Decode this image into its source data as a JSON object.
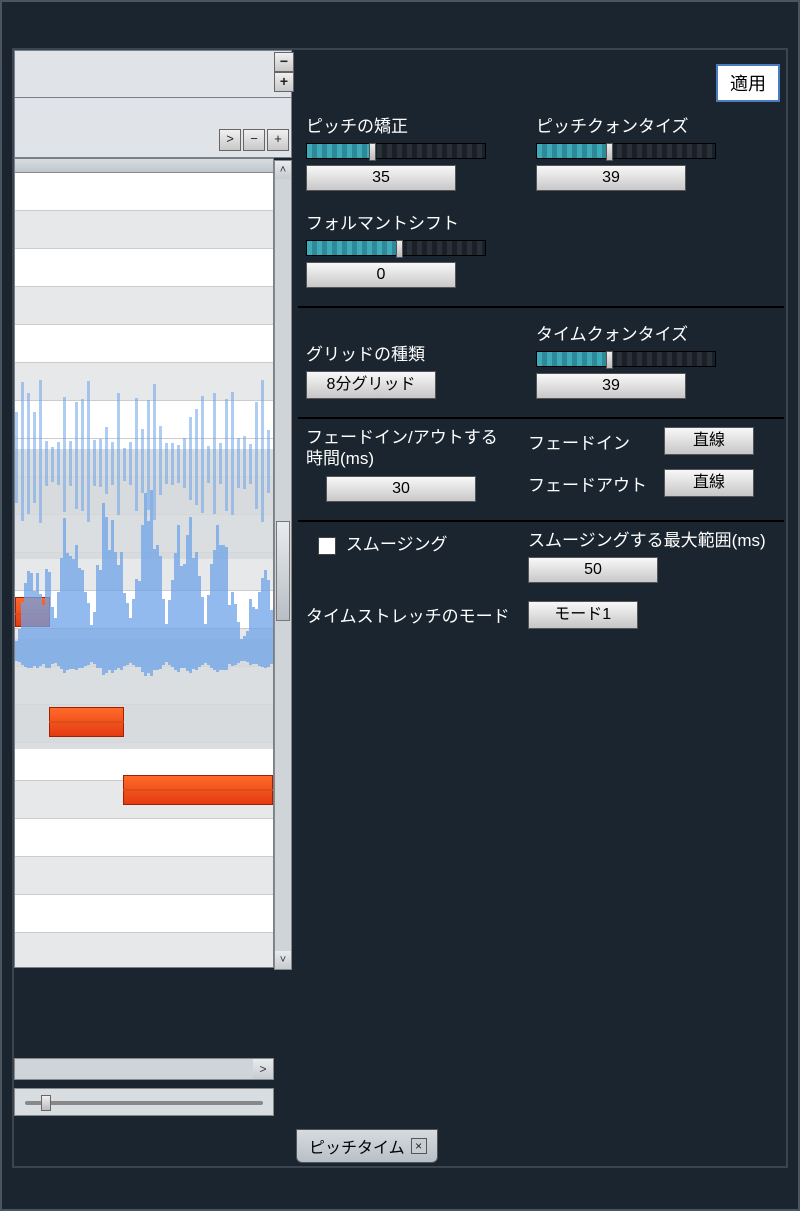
{
  "apply_button": "適用",
  "params": {
    "pitch_correction": {
      "label": "ピッチの矯正",
      "value": "35",
      "percent": 35
    },
    "pitch_quantize": {
      "label": "ピッチクォンタイズ",
      "value": "39",
      "percent": 39
    },
    "formant_shift": {
      "label": "フォルマントシフト",
      "value": "0",
      "percent": 50
    },
    "grid_type": {
      "label": "グリッドの種類",
      "value": "8分グリッド"
    },
    "time_quantize": {
      "label": "タイムクォンタイズ",
      "value": "39",
      "percent": 39
    },
    "fade_time": {
      "label": "フェードイン/アウトする時間(ms)",
      "value": "30"
    },
    "fade_in": {
      "label": "フェードイン",
      "value": "直線"
    },
    "fade_out": {
      "label": "フェードアウト",
      "value": "直線"
    },
    "smoothing_check": {
      "label": "スムージング"
    },
    "smoothing_range": {
      "label": "スムージングする最大範囲(ms)",
      "value": "50"
    },
    "timestretch_mode": {
      "label": "タイムストレッチのモード",
      "value": "モード1"
    }
  },
  "tab": {
    "label": "ピッチタイム"
  }
}
